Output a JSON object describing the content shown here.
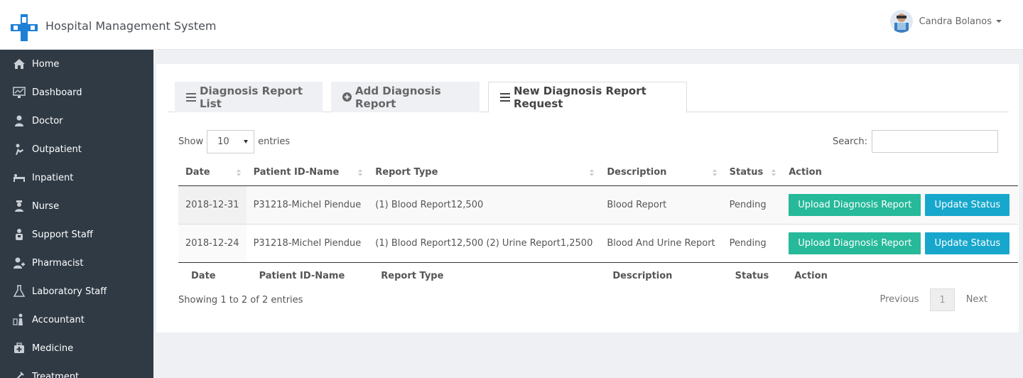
{
  "app": {
    "title": "Hospital Management System"
  },
  "user": {
    "name": "Candra Bolanos"
  },
  "sidebar": {
    "items": [
      {
        "label": "Home",
        "icon": "home-icon"
      },
      {
        "label": "Dashboard",
        "icon": "dashboard-icon"
      },
      {
        "label": "Doctor",
        "icon": "doctor-icon"
      },
      {
        "label": "Outpatient",
        "icon": "outpatient-icon"
      },
      {
        "label": "Inpatient",
        "icon": "inpatient-icon"
      },
      {
        "label": "Nurse",
        "icon": "nurse-icon"
      },
      {
        "label": "Support Staff",
        "icon": "support-staff-icon"
      },
      {
        "label": "Pharmacist",
        "icon": "pharmacist-icon"
      },
      {
        "label": "Laboratory Staff",
        "icon": "flask-icon"
      },
      {
        "label": "Accountant",
        "icon": "accountant-icon"
      },
      {
        "label": "Medicine",
        "icon": "medicine-icon"
      },
      {
        "label": "Treatment",
        "icon": "treatment-icon"
      }
    ]
  },
  "tabs": [
    {
      "label": "Diagnosis Report List",
      "icon": "list-icon"
    },
    {
      "label": "Add Diagnosis Report",
      "icon": "plus-circle-icon"
    },
    {
      "label": "New Diagnosis Report Request",
      "icon": "list-icon",
      "active": true
    }
  ],
  "table_controls": {
    "show_label": "Show",
    "page_size": "10",
    "entries_label": "entries",
    "search_label": "Search:",
    "search_value": ""
  },
  "table": {
    "columns": [
      "Date",
      "Patient ID-Name",
      "Report Type",
      "Description",
      "Status",
      "Action"
    ],
    "rows": [
      {
        "date": "2018-12-31",
        "patient": "P31218-Michel Piendue",
        "report_type": "(1) Blood Report12,500",
        "description": "Blood Report",
        "status": "Pending",
        "action_upload": "Upload Diagnosis Report",
        "action_update": "Update Status"
      },
      {
        "date": "2018-12-24",
        "patient": "P31218-Michel Piendue",
        "report_type": "(1) Blood Report12,500 (2) Urine Report1,2500",
        "description": "Blood And Urine Report",
        "status": "Pending",
        "action_upload": "Upload Diagnosis Report",
        "action_update": "Update Status"
      }
    ]
  },
  "footer": {
    "info": "Showing 1 to 2 of 2 entries",
    "previous": "Previous",
    "page": "1",
    "next": "Next"
  },
  "colors": {
    "sidebar_bg": "#2f3a45",
    "upload_button": "#26b99a",
    "update_button": "#17a7cc",
    "logo_blue": "#1e7fd6"
  }
}
